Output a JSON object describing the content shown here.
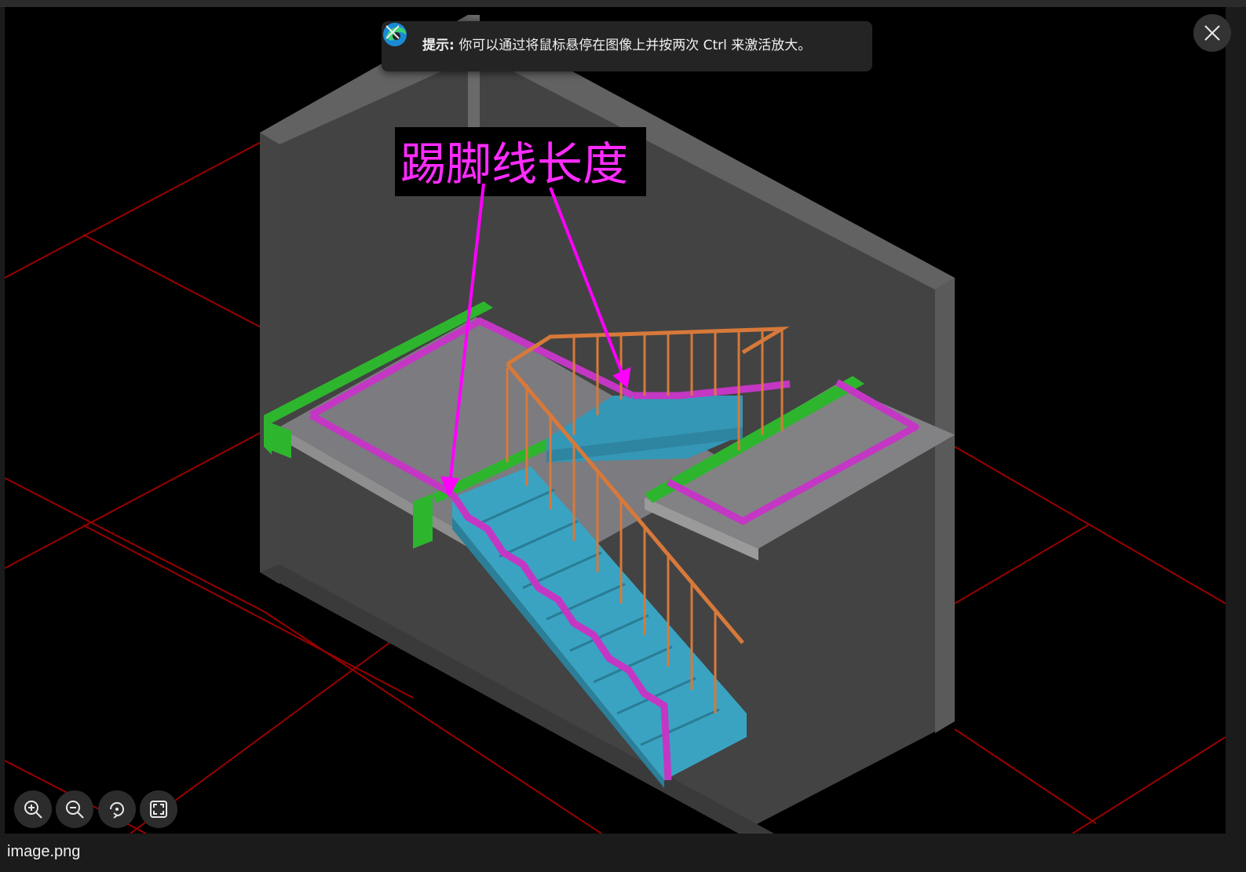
{
  "viewer": {
    "image_label": "踢脚线长度",
    "filename": "image.png"
  },
  "toast": {
    "title": "提示:",
    "message": "你可以通过将鼠标悬停在图像上并按两次 Ctrl 来激活放大。",
    "icon": "edge-logo-icon"
  },
  "toolbar": {
    "buttons": [
      {
        "icon": "zoom-in-icon"
      },
      {
        "icon": "zoom-out-icon"
      },
      {
        "icon": "rotate-icon"
      },
      {
        "icon": "fit-screen-icon"
      }
    ]
  },
  "colors": {
    "accent_magenta": "#ff00ff",
    "stair_blue": "#3aa0c0",
    "rail_orange": "#d77a3a",
    "beam_green": "#2fb52f",
    "grid_red": "#a00000"
  }
}
